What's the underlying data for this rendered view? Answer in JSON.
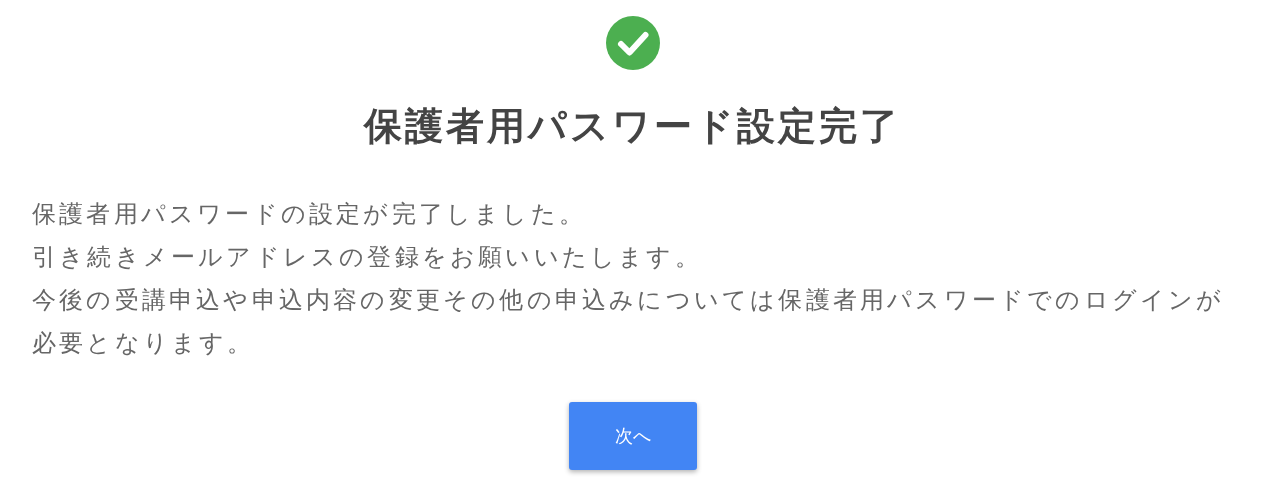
{
  "title": "保護者用パスワード設定完了",
  "message_lines": [
    "保護者用パスワードの設定が完了しました。",
    "引き続きメールアドレスの登録をお願いいたします。",
    "今後の受講申込や申込内容の変更その他の申込みについては保護者用パスワードでのログインが必要となります。"
  ],
  "button": {
    "label": "次へ"
  }
}
